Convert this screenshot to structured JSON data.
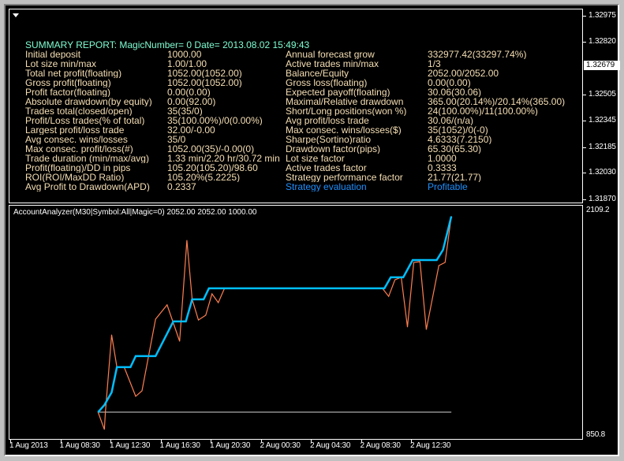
{
  "report": {
    "title": "SUMMARY REPORT: MagicNumber=    0 Date= 2013.08.02 15:49:43",
    "rows": [
      {
        "label": "Initial deposit",
        "value": "1000.00",
        "label2": "Annual forecast grow",
        "value2": "332977.42(33297.74%)"
      },
      {
        "label": "Lot size min/max",
        "value": "1.00/1.00",
        "label2": "Active trades min/max",
        "value2": "1/3"
      },
      {
        "label": "Total net profit(floating)",
        "value": "1052.00(1052.00)",
        "label2": "Balance/Equity",
        "value2": "2052.00/2052.00"
      },
      {
        "label": "Gross profit(floating)",
        "value": "1052.00(1052.00)",
        "label2": "Gross loss(floating)",
        "value2": "0.00(0.00)"
      },
      {
        "label": "Profit factor(floating)",
        "value": "0.00(0.00)",
        "label2": "Expected payoff(floating)",
        "value2": "30.06(30.06)"
      },
      {
        "label": "Absolute drawdown(by equity)",
        "value": "0.00(92.00)",
        "label2": "Maximal/Relative drawdown",
        "value2": "365.00(20.14%)/20.14%(365.00)"
      },
      {
        "label": "Trades total(closed/open)",
        "value": "35(35/0)",
        "label2": "Short/Long positions(won %)",
        "value2": "24(100.00%)/11(100.00%)"
      },
      {
        "label": "Profit/Loss trades(% of total)",
        "value": "35(100.00%)/0(0.00%)",
        "label2": "Avg profit/loss trade",
        "value2": "30.06/(n/a)"
      },
      {
        "label": "Largest profit/loss trade",
        "value": "32.00/-0.00",
        "label2": "Max consec. wins/losses($)",
        "value2": "35(1052)/0(-0)"
      },
      {
        "label": "Avg consec. wins/losses",
        "value": "35/0",
        "label2": "Sharpe(Sortino)ratio",
        "value2": "4.6333(7.2150)"
      },
      {
        "label": "Max consec. profit/loss(#)",
        "value": "1052.00(35)/-0.00(0)",
        "label2": "Drawdown factor(pips)",
        "value2": "65.30(65.30)"
      },
      {
        "label": "Trade duration (min/max/avg)",
        "value": "1.33 min/2.20 hr/30.72 min",
        "label2": "Lot size factor",
        "value2": "1.0000"
      },
      {
        "label": "Profit(floating)/DD in pips",
        "value": "105.20(105.20)/98.60",
        "label2": "Active trades factor",
        "value2": "0.3333"
      },
      {
        "label": "ROI(ROI/MaxDD Ratio)",
        "value": "105.20%(5.2225)",
        "label2": "Strategy performance factor",
        "value2": "21.77(21.77)"
      },
      {
        "label": "Avg Profit to Drawdown(APD)",
        "value": "0.2337",
        "label2": "Strategy evaluation",
        "value2": "Profitable"
      }
    ]
  },
  "price_axis": {
    "labels": [
      "1.32975",
      "1.32820",
      "1.32505",
      "1.32345",
      "1.32185",
      "1.32030",
      "1.31870"
    ],
    "current_price": "1.32679"
  },
  "indicator": {
    "title": "AccountAnalyzer(M30|Symbol:All|Magic=0) 2052.00 2052.00 1000.00"
  },
  "chart_data": {
    "type": "line",
    "y_axis_labels": {
      "max": "2109.2",
      "min": "850.8"
    },
    "ylim": [
      850.8,
      2109.2
    ],
    "xlim": [
      "2013-08-01 04:30",
      "2013-08-03 02:05"
    ],
    "x_tick_labels": [
      "1 Aug 2013",
      "1 Aug 08:30",
      "1 Aug 12:30",
      "1 Aug 16:30",
      "1 Aug 20:30",
      "2 Aug 00:30",
      "2 Aug 04:30",
      "2 Aug 08:30",
      "2 Aug 12:30"
    ],
    "grid": false,
    "colors": {
      "balance": "#00bfff",
      "equity": "#ff7f50",
      "baseline": "#d3d3d3"
    },
    "baseline": {
      "value": 1000,
      "x": [
        "2013-08-01 11:30",
        "2013-08-02 15:40"
      ]
    },
    "series": [
      {
        "key": "equity",
        "points": [
          [
            "2013-08-01 11:30",
            1000
          ],
          [
            "2013-08-01 12:00",
            903
          ],
          [
            "2013-08-01 12:05",
            1000
          ],
          [
            "2013-08-01 12:35",
            1434
          ],
          [
            "2013-08-01 13:00",
            1253
          ],
          [
            "2013-08-01 13:35",
            1253
          ],
          [
            "2013-08-01 14:30",
            1089
          ],
          [
            "2013-08-01 15:00",
            1120
          ],
          [
            "2013-08-01 16:05",
            1523
          ],
          [
            "2013-08-01 17:00",
            1603
          ],
          [
            "2013-08-01 18:00",
            1399
          ],
          [
            "2013-08-01 18:35",
            1966
          ],
          [
            "2013-08-01 19:00",
            1634
          ],
          [
            "2013-08-01 19:30",
            1518
          ],
          [
            "2013-08-01 20:05",
            1545
          ],
          [
            "2013-08-01 20:35",
            1665
          ],
          [
            "2013-08-01 21:05",
            1616
          ],
          [
            "2013-08-01 21:35",
            1696
          ],
          [
            "2013-08-02 10:10",
            1696
          ],
          [
            "2013-08-02 10:40",
            1651
          ],
          [
            "2013-08-02 11:10",
            1744
          ],
          [
            "2013-08-02 11:40",
            1758
          ],
          [
            "2013-08-02 12:10",
            1479
          ],
          [
            "2013-08-02 12:40",
            1842
          ],
          [
            "2013-08-02 13:10",
            1846
          ],
          [
            "2013-08-02 13:40",
            1465
          ],
          [
            "2013-08-02 14:40",
            1824
          ],
          [
            "2013-08-02 15:10",
            1842
          ],
          [
            "2013-08-02 15:40",
            2100
          ]
        ]
      },
      {
        "key": "balance",
        "points": [
          [
            "2013-08-01 11:30",
            1000
          ],
          [
            "2013-08-01 12:00",
            1040
          ],
          [
            "2013-08-01 12:35",
            1111
          ],
          [
            "2013-08-01 13:00",
            1253
          ],
          [
            "2013-08-01 14:05",
            1253
          ],
          [
            "2013-08-01 14:30",
            1315
          ],
          [
            "2013-08-01 16:05",
            1315
          ],
          [
            "2013-08-01 17:30",
            1510
          ],
          [
            "2013-08-01 18:30",
            1510
          ],
          [
            "2013-08-01 19:00",
            1634
          ],
          [
            "2013-08-01 19:55",
            1634
          ],
          [
            "2013-08-01 20:20",
            1696
          ],
          [
            "2013-08-02 10:20",
            1696
          ],
          [
            "2013-08-02 10:50",
            1758
          ],
          [
            "2013-08-02 11:50",
            1758
          ],
          [
            "2013-08-02 12:35",
            1855
          ],
          [
            "2013-08-02 14:30",
            1855
          ],
          [
            "2013-08-02 15:00",
            1913
          ],
          [
            "2013-08-02 15:40",
            2100
          ]
        ]
      }
    ]
  }
}
